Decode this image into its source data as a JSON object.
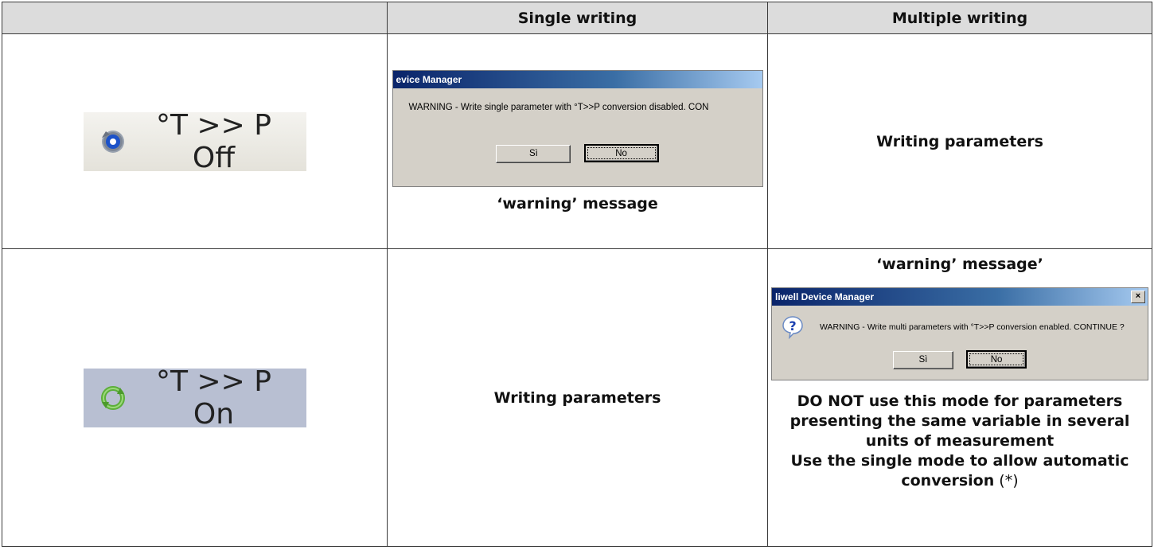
{
  "header": {
    "col1": "",
    "col2": "Single writing",
    "col3": "Multiple writing"
  },
  "row1": {
    "button": {
      "label": "°T >> P Off",
      "icon": "gear-blue-icon"
    },
    "single": {
      "dialog": {
        "title": "evice Manager",
        "message": "WARNING - Write single parameter with °T>>P conversion  disabled. CON",
        "yes": "Sì",
        "no": "No"
      },
      "caption": "‘warning’ message"
    },
    "multiple": {
      "text": "Writing parameters"
    }
  },
  "row2": {
    "button": {
      "label": "°T >> P On",
      "icon": "refresh-green-icon"
    },
    "single": {
      "text": "Writing parameters"
    },
    "multiple": {
      "heading": "‘warning’ message’",
      "dialog": {
        "title": "liwell Device Manager",
        "close": "×",
        "message": "WARNING - Write multi parameters with °T>>P conversion enabled. CONTINUE ?",
        "yes": "Sì",
        "no": "No",
        "icon": "question-icon"
      },
      "note_lines": [
        "DO NOT use this mode for parameters",
        "presenting the same variable in several",
        "units of measurement",
        "Use the single mode to allow automatic"
      ],
      "note_last": "conversion",
      "note_suffix": " (*)"
    }
  }
}
